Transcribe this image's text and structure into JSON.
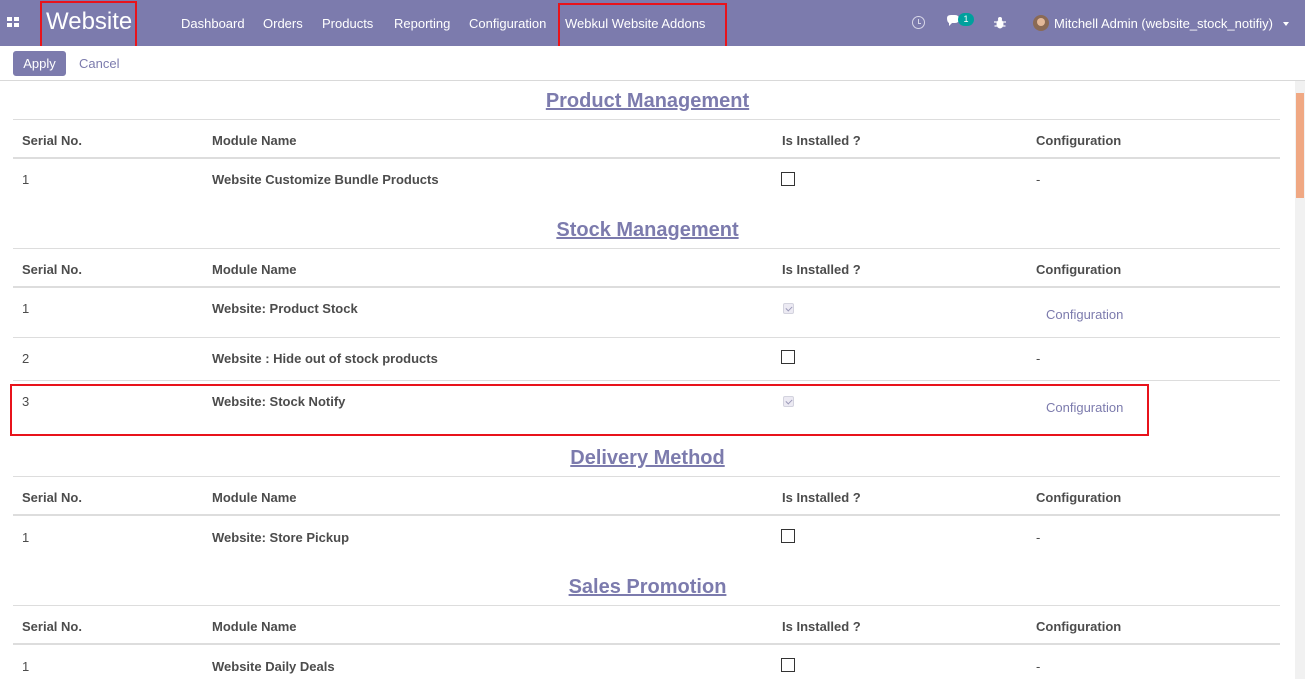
{
  "navbar": {
    "brand": "Website",
    "menu": [
      "Dashboard",
      "Orders",
      "Products",
      "Reporting",
      "Configuration",
      "Webkul Website Addons"
    ],
    "chat_count": "1",
    "user": "Mitchell Admin (website_stock_notifiy)",
    "accent_color": "#7c7bad"
  },
  "control_panel": {
    "apply_label": "Apply",
    "cancel_label": "Cancel"
  },
  "table_headers": {
    "serial": "Serial No.",
    "module": "Module Name",
    "installed": "Is Installed ?",
    "configuration": "Configuration"
  },
  "sections": [
    {
      "title": "Product Management",
      "rows": [
        {
          "serial": "1",
          "module": "Website Customize Bundle Products",
          "installed": false,
          "config": "-"
        }
      ]
    },
    {
      "title": "Stock Management",
      "rows": [
        {
          "serial": "1",
          "module": "Website: Product Stock",
          "installed": true,
          "config": "Configuration"
        },
        {
          "serial": "2",
          "module": "Website : Hide out of stock products",
          "installed": false,
          "config": "-"
        },
        {
          "serial": "3",
          "module": "Website: Stock Notify",
          "installed": true,
          "config": "Configuration"
        }
      ]
    },
    {
      "title": "Delivery Method",
      "rows": [
        {
          "serial": "1",
          "module": "Website: Store Pickup",
          "installed": false,
          "config": "-"
        }
      ]
    },
    {
      "title": "Sales Promotion",
      "rows": [
        {
          "serial": "1",
          "module": "Website Daily Deals",
          "installed": false,
          "config": "-"
        }
      ]
    }
  ]
}
